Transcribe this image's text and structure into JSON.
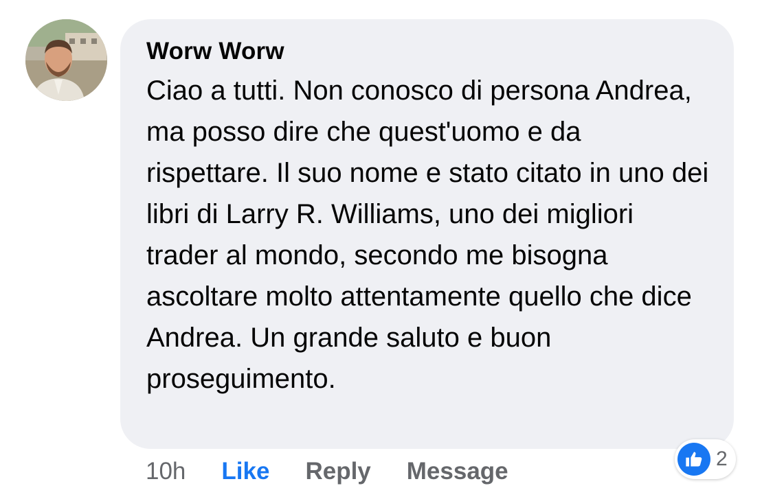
{
  "comment": {
    "author": "Worw Worw",
    "text": "Ciao a tutti. Non conosco di persona Andrea, ma posso dire che quest'uomo e da rispettare. Il suo nome e stato citato in uno dei libri di Larry R. Williams, uno dei migliori trader al mondo, secondo me bisogna ascoltare molto attentamente quello che dice Andrea. Un grande saluto e buon proseguimento.",
    "time": "10h"
  },
  "actions": {
    "like_label": "Like",
    "reply_label": "Reply",
    "message_label": "Message"
  },
  "reactions": {
    "icon": "thumbs-up-icon",
    "count": "2"
  },
  "colors": {
    "accent": "#1877f2",
    "bubble": "#eff0f4",
    "secondary_text": "#65676b"
  }
}
